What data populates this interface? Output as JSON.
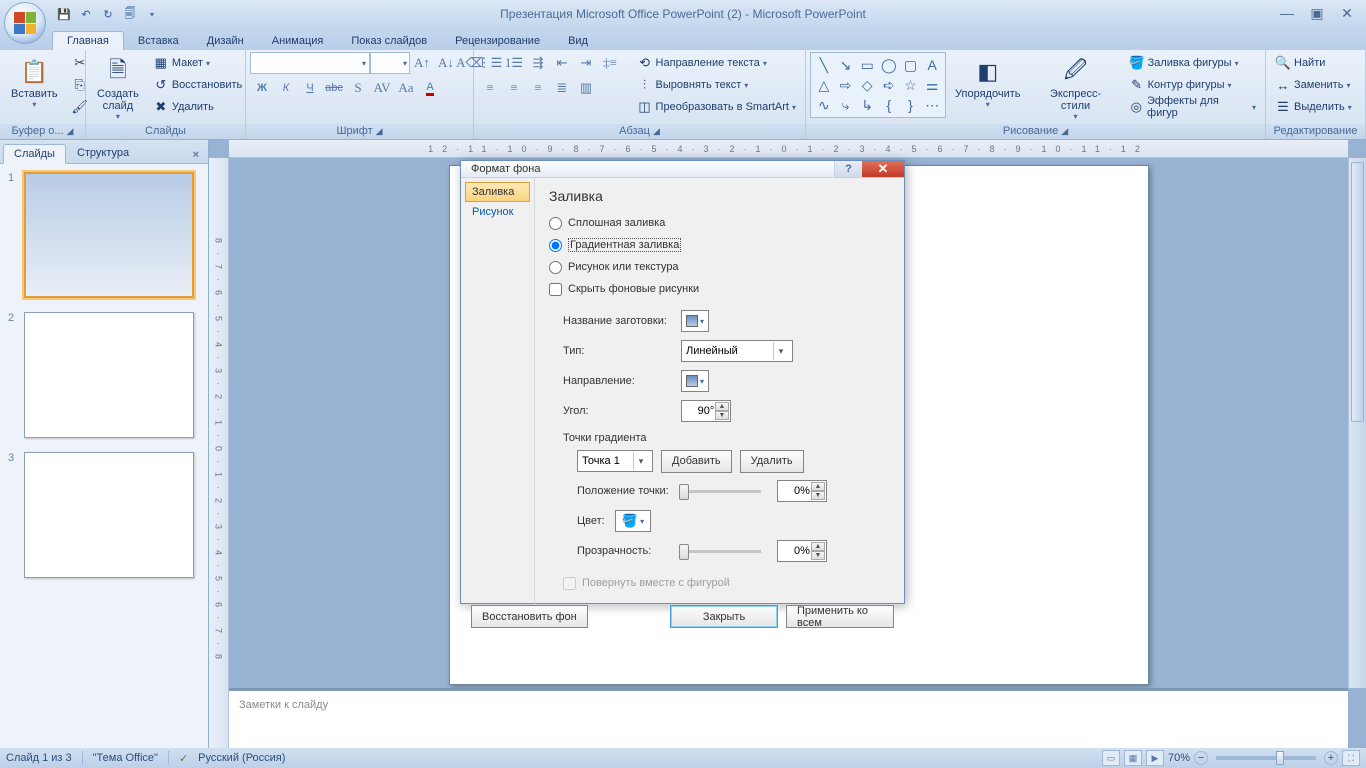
{
  "title": "Презентация Microsoft Office PowerPoint (2) - Microsoft PowerPoint",
  "tabs": {
    "home": "Главная",
    "insert": "Вставка",
    "design": "Дизайн",
    "animation": "Анимация",
    "slideshow": "Показ слайдов",
    "review": "Рецензирование",
    "view": "Вид"
  },
  "ribbon": {
    "clipboard": {
      "label": "Буфер о...",
      "paste": "Вставить"
    },
    "slides": {
      "label": "Слайды",
      "new": "Создать\nслайд",
      "layout": "Макет",
      "reset": "Восстановить",
      "delete": "Удалить"
    },
    "font": {
      "label": "Шрифт"
    },
    "paragraph": {
      "label": "Абзац",
      "textdir": "Направление текста",
      "align": "Выровнять текст",
      "smartart": "Преобразовать в SmartArt"
    },
    "drawing": {
      "label": "Рисование",
      "arrange": "Упорядочить",
      "quickstyles": "Экспресс-стили",
      "fill": "Заливка фигуры",
      "outline": "Контур фигуры",
      "effects": "Эффекты для фигур"
    },
    "editing": {
      "label": "Редактирование",
      "find": "Найти",
      "replace": "Заменить",
      "select": "Выделить"
    }
  },
  "sidepanel": {
    "slides_tab": "Слайды",
    "outline_tab": "Структура"
  },
  "ruler_h": "12·11·10·9·8·7·6·5·4·3·2·1·0·1·2·3·4·5·6·7·8·9·10·11·12",
  "ruler_v": "8·7·6·5·4·3·2·1·0·1·2·3·4·5·6·7·8",
  "notes_placeholder": "Заметки к слайду",
  "status": {
    "slide": "Слайд 1 из 3",
    "theme": "\"Тема Office\"",
    "lang": "Русский (Россия)",
    "zoom": "70%"
  },
  "dialog": {
    "title": "Формат фона",
    "nav": {
      "fill": "Заливка",
      "picture": "Рисунок"
    },
    "heading": "Заливка",
    "opt_solid": "Сплошная заливка",
    "opt_gradient": "Градиентная заливка",
    "opt_picture": "Рисунок или текстура",
    "chk_hide": "Скрыть фоновые рисунки",
    "preset_lbl": "Название заготовки:",
    "type_lbl": "Тип:",
    "type_val": "Линейный",
    "direction_lbl": "Направление:",
    "angle_lbl": "Угол:",
    "angle_val": "90°",
    "stops_lbl": "Точки градиента",
    "stop_val": "Точка 1",
    "add": "Добавить",
    "remove": "Удалить",
    "pos_lbl": "Положение точки:",
    "pos_val": "0%",
    "color_lbl": "Цвет:",
    "trans_lbl": "Прозрачность:",
    "trans_val": "0%",
    "rotate_chk": "Повернуть вместе с фигурой",
    "reset_bg": "Восстановить фон",
    "close": "Закрыть",
    "apply_all": "Применить ко всем"
  }
}
